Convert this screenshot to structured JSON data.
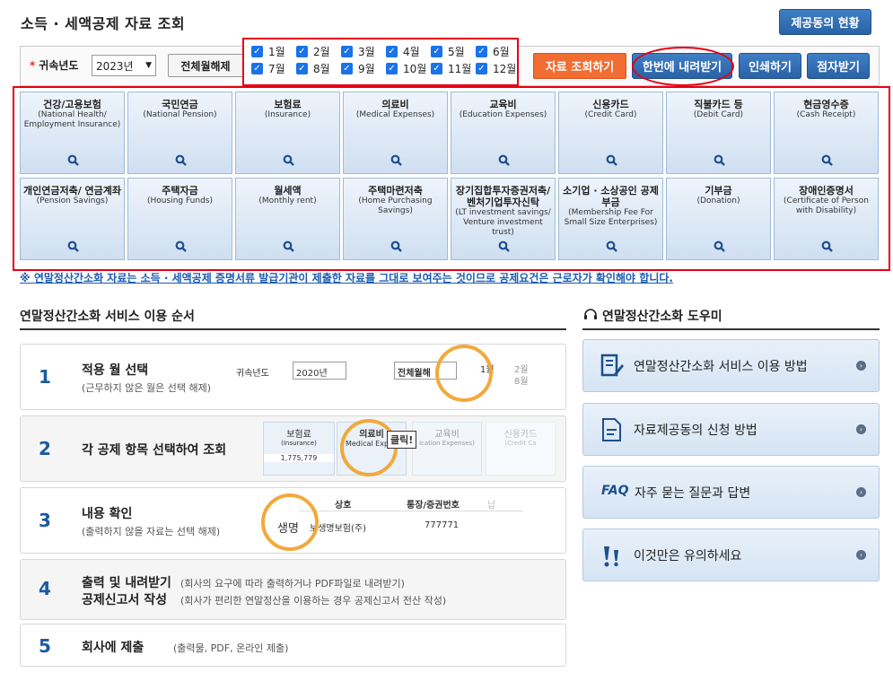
{
  "page": {
    "title": "소득 · 세액공제 자료 조회",
    "provider_button": "제공동의 현황"
  },
  "filter": {
    "year_label": "귀속년도",
    "year_value": "2023년",
    "deselect_all": "전체월해제",
    "months": [
      "1월",
      "2월",
      "3월",
      "4월",
      "5월",
      "6월",
      "7월",
      "8월",
      "9월",
      "10월",
      "11월",
      "12월"
    ],
    "query_button": "자료 조회하기",
    "download_all_button": "한번에 내려받기",
    "print_button": "인쇄하기",
    "digital_button": "점자받기"
  },
  "categories": [
    {
      "ko": "건강/고용보험",
      "en": "(National Health/ Employment Insurance)"
    },
    {
      "ko": "국민연금",
      "en": "(National Pension)"
    },
    {
      "ko": "보험료",
      "en": "(Insurance)"
    },
    {
      "ko": "의료비",
      "en": "(Medical Expenses)"
    },
    {
      "ko": "교육비",
      "en": "(Education Expenses)"
    },
    {
      "ko": "신용카드",
      "en": "(Credit Card)"
    },
    {
      "ko": "직불카드 등",
      "en": "(Debit Card)"
    },
    {
      "ko": "현금영수증",
      "en": "(Cash Receipt)"
    },
    {
      "ko": "개인연금저축/ 연금계좌",
      "en": "(Pension Savings)"
    },
    {
      "ko": "주택자금",
      "en": "(Housing Funds)"
    },
    {
      "ko": "월세액",
      "en": "(Monthly rent)"
    },
    {
      "ko": "주택마련저축",
      "en": "(Home Purchasing Savings)"
    },
    {
      "ko": "장기집합투자증권저축/ 벤처기업투자신탁",
      "en": "(LT investment savings/ Venture investment trust)"
    },
    {
      "ko": "소기업 · 소상공인 공제부금",
      "en": "(Membership Fee For Small Size Enterprises)"
    },
    {
      "ko": "기부금",
      "en": "(Donation)"
    },
    {
      "ko": "장애인증명서",
      "en": "(Certificate of Person with Disability)"
    }
  ],
  "notice": "※ 연말정산간소화 자료는 소득 · 세액공제 증명서류 발급기관이 제출한 자료를 그대로 보여주는 것이므로 공제요건은 근로자가 확인해야 합니다.",
  "steps_section": {
    "title": "연말정산간소화 서비스 이용 순서",
    "steps": [
      {
        "num": "1",
        "title": "적용 월 선택",
        "sub": "(근무하지 않은 월은 선택 해제)"
      },
      {
        "num": "2",
        "title": "각 공제 항목 선택하여 조회",
        "sub": ""
      },
      {
        "num": "3",
        "title": "내용 확인",
        "sub": "(출력하지 않을 자료는 선택 해제)"
      },
      {
        "num": "4",
        "title": "출력 및 내려받기",
        "title2": "공제신고서 작성",
        "sub": "(회사의 요구에 따라 출력하거나 PDF파일로 내려받기)",
        "sub2": "(회사가 편리한 연말정산을 이용하는 경우 공제신고서 전산 작성)"
      },
      {
        "num": "5",
        "title": "회사에 제출",
        "sub": "(출력물, PDF, 온라인 제출)"
      }
    ],
    "illus": {
      "s1_year_label": "귀속년도",
      "s1_year": "2020년",
      "s1_deselect": "전체월해",
      "s1_m1": "1월",
      "s1_m2": "2월",
      "s1_m3": "8월",
      "s2_c1": "보험료",
      "s2_c1en": "(Insurance)",
      "s2_c1val": "1,775,779",
      "s2_c2": "의료비",
      "s2_c2en": "Medical Expen",
      "s2_c3": "교육비",
      "s2_c3en": "ication Expenses)",
      "s2_c4": "신용카드",
      "s2_c4en": "(Credit Ca",
      "s2_click": "클릭!",
      "s3_col1": "상호",
      "s3_col2": "통장/증권번호",
      "s3_col3": "납",
      "s3_r1": "생명",
      "s3_r1b": "보생명보험(주)",
      "s3_r1c": "777771"
    }
  },
  "helper_section": {
    "title": "연말정산간소화 도우미",
    "items": [
      {
        "label": "연말정산간소화 서비스 이용 방법",
        "icon": "edit-doc-icon"
      },
      {
        "label": "자료제공동의 신청 방법",
        "icon": "document-icon"
      },
      {
        "label": "자주 묻는 질문과 답변",
        "icon": "faq-icon",
        "prefix": "FAQ"
      },
      {
        "label": "이것만은 유의하세요",
        "icon": "exclamation-icon"
      }
    ]
  },
  "colors": {
    "blue": "#2a62a6",
    "orange": "#f26d32",
    "highlight": "#e60012",
    "card_top": "#eef4fb",
    "card_bottom": "#cfdff1"
  }
}
